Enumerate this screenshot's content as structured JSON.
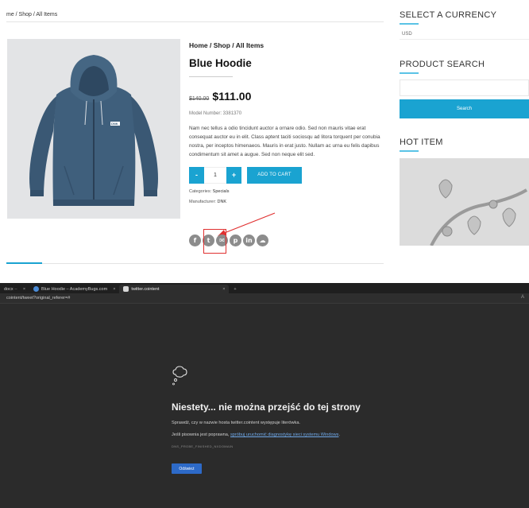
{
  "shop": {
    "breadcrumb_top": "me / Shop / All Items",
    "breadcrumb": "Home / Shop / All Items",
    "title": "Blue Hoodie",
    "old_price": "$140.00",
    "price": "$111.00",
    "model": "Model Number: 3381370",
    "description": "Nam nec tellus a odio tincidunt auctor a ornare odio. Sed non mauris vitae erat consequat auctor eu in elit. Class aptent taciti sociosqu ad litora torquent per conubia nostra, per inceptos himenaeos. Mauris in erat justo. Nullam ac urna eu felis dapibus condimentum sit amet a augue. Sed non neque elit sed.",
    "qty_minus": "-",
    "qty_value": "1",
    "qty_plus": "+",
    "add_to_cart": "ADD TO CART",
    "categories_label": "Categories:",
    "categories_value": "Specials",
    "manufacturer_label": "Manufacturer:",
    "manufacturer_value": "DNK",
    "hoodie_logo": "DNK",
    "social": {
      "facebook": "f",
      "twitter": "t",
      "email": "✉",
      "pinterest": "p",
      "linkedin": "in",
      "other": "☁"
    }
  },
  "sidebar": {
    "currency_heading": "SELECT A CURRENCY",
    "currency_value": "USD",
    "search_heading": "PRODUCT SEARCH",
    "search_button": "Search",
    "hot_heading": "HOT ITEM"
  },
  "browser": {
    "tabs": [
      {
        "label": "docx ·· "
      },
      {
        "label": "Blue Hoodie – AcademyBugs.com"
      },
      {
        "label": "twitter.cointent"
      }
    ],
    "tab_close": "×",
    "new_tab": "+",
    "address": "cointent/tweet?original_referer=#",
    "address_icon": "A",
    "error": {
      "title": "Niestety... nie można przejść do tej strony",
      "line1": "Sprawdź, czy w nazwie hosta twitter.cointent występuje literówka.",
      "line2_prefix": "Jeśli pisownia jest poprawna, ",
      "line2_link": "spróbuj uruchomić diagnostykę sieci systemu Windows",
      "line2_suffix": ".",
      "code": "DNS_PROBE_FINISHED_NXDOMAIN",
      "refresh_button": "Odśwież"
    }
  },
  "colors": {
    "accent_blue": "#1aa3d1",
    "annotation_red": "#e03030",
    "browser_bg": "#2b2b2b",
    "refresh_blue": "#2d6ac8"
  }
}
